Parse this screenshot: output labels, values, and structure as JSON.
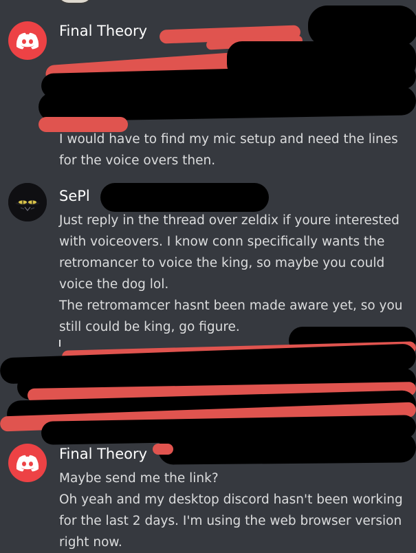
{
  "colors": {
    "background": "#36393f",
    "text": "#dcddde",
    "username": "#ffffff",
    "discord_red": "#ed4245",
    "redaction_red": "#e0544f",
    "redaction_black": "#000000"
  },
  "messages": [
    {
      "avatar_icon": "discord-logo-icon",
      "username": "Final Theory",
      "lines": [
        "I would have to find my mic setup and need the lines",
        "for the voice overs then."
      ]
    },
    {
      "avatar_icon": "cat-eyes-icon",
      "username": "SePl",
      "lines": [
        "Just reply in the thread over zeldix if youre interested",
        "with voiceovers. I know conn specifically wants the",
        "retromancer to voice the king, so maybe you could",
        "voice the dog lol.",
        "The retromamcer hasnt been made aware yet, so you",
        "still could be king, go figure."
      ]
    },
    {
      "avatar_icon": "discord-logo-icon",
      "username": "Final Theory",
      "lines": [
        "Maybe send me the link?",
        "Oh yeah and my desktop discord hasn't been working",
        "for the last 2 days. I'm using the web browser version",
        "right now."
      ]
    }
  ]
}
